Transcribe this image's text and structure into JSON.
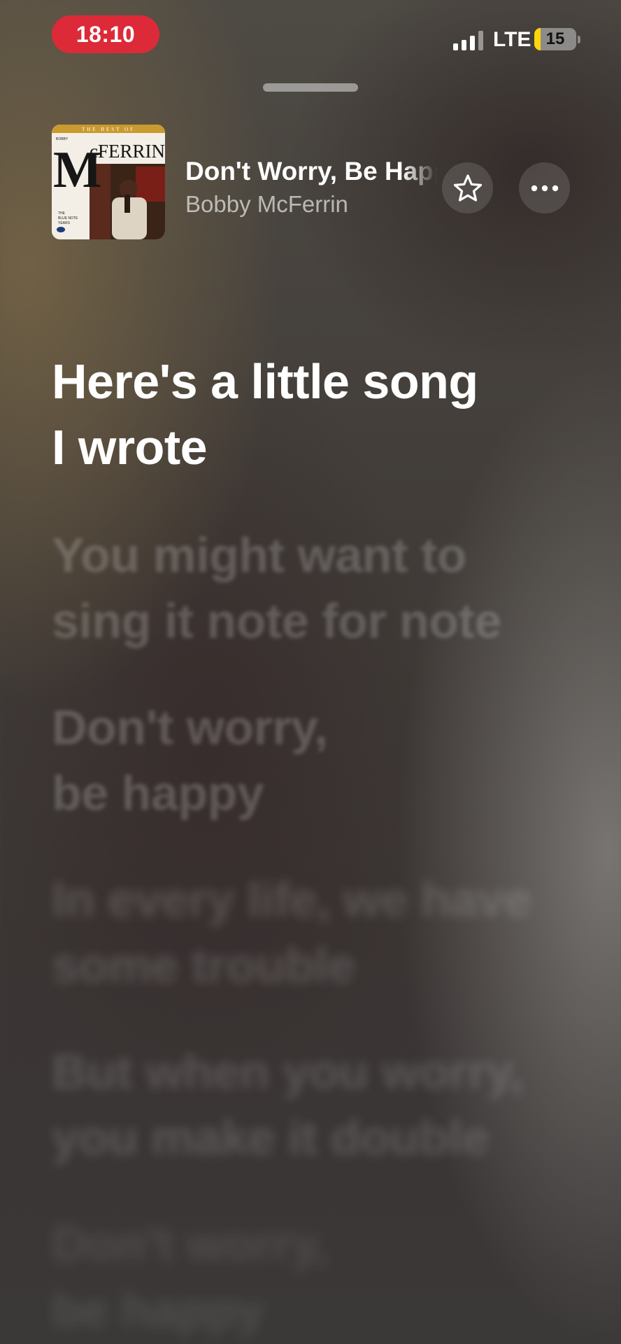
{
  "status_bar": {
    "time": "18:10",
    "network": "LTE",
    "battery_level": "15",
    "battery_fraction": 0.15
  },
  "now_playing": {
    "title": "Don't Worry, Be Happy",
    "artist": "Bobby McFerrin",
    "album_art": {
      "top_text": "THE BEST OF",
      "small_artist": "BOBBY",
      "name_letter": "M",
      "name_rest": "cFERRIN",
      "series": [
        "THE",
        "BLUE NOTE",
        "YEARS"
      ]
    },
    "favorite_icon": "star-icon",
    "more_icon": "ellipsis-icon"
  },
  "lyrics": [
    {
      "state": "active",
      "lines": [
        "Here's a little song",
        "I wrote"
      ]
    },
    {
      "state": "upcoming",
      "lines": [
        "You might want to",
        "sing it note for note"
      ]
    },
    {
      "state": "upcoming",
      "lines": [
        "Don't worry,",
        "be happy"
      ]
    },
    {
      "state": "far",
      "lines": [
        "In every life, we have",
        "some trouble"
      ]
    },
    {
      "state": "far",
      "lines": [
        "But when you worry,",
        "you make it double"
      ]
    },
    {
      "state": "farther",
      "lines": [
        "Don't worry,",
        "be happy"
      ]
    }
  ],
  "colors": {
    "recording_pill": "#dd2a38",
    "battery_low": "#ffd60a"
  }
}
